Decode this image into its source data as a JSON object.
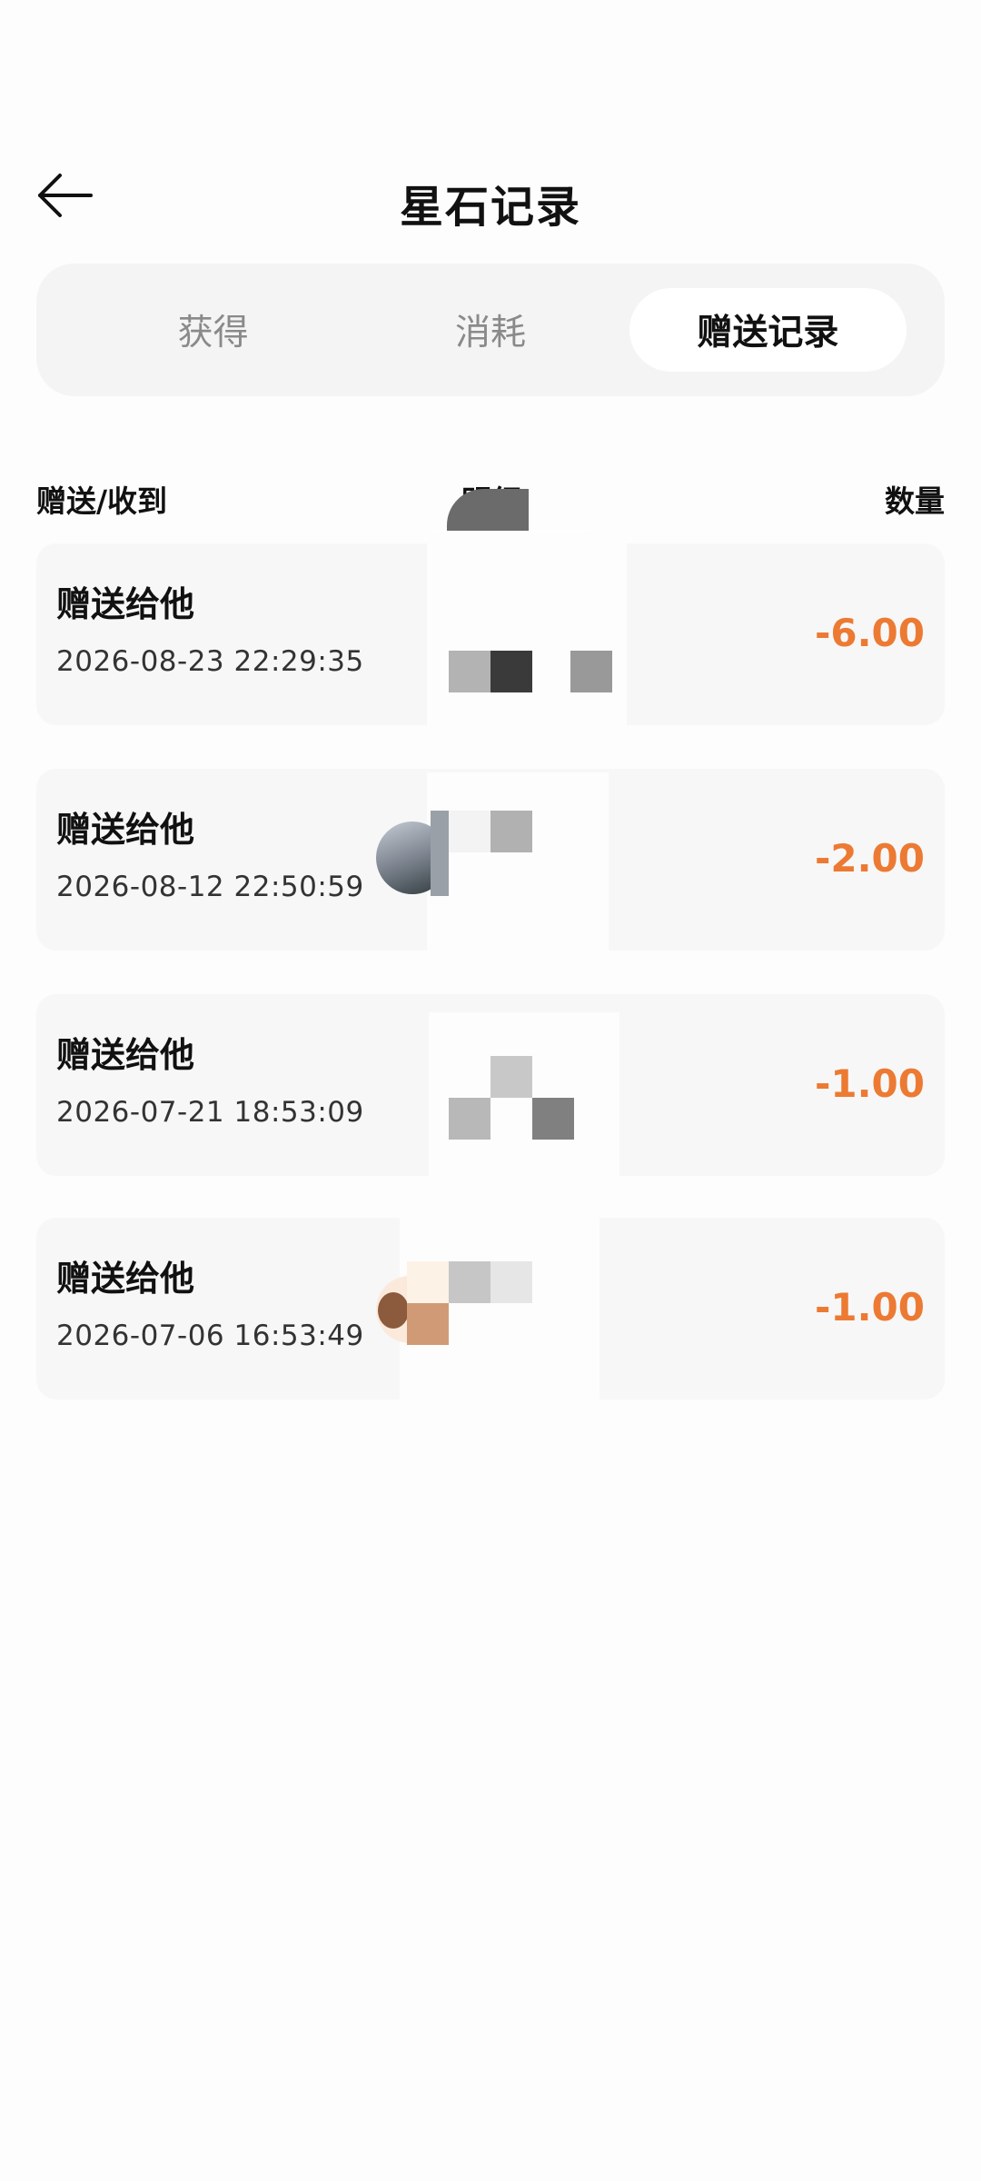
{
  "header": {
    "title": "星石记录",
    "back_icon": "arrow-left-icon"
  },
  "tabs": [
    {
      "label": "获得",
      "active": false
    },
    {
      "label": "消耗",
      "active": false
    },
    {
      "label": "赠送记录",
      "active": true
    }
  ],
  "columns": {
    "left": "赠送/收到",
    "middle": "明细",
    "right": "数量"
  },
  "records": [
    {
      "title": "赠送给他",
      "time": "2026-08-23 22:29:35",
      "amount": "-6.00"
    },
    {
      "title": "赠送给他",
      "time": "2026-08-12 22:50:59",
      "amount": "-2.00"
    },
    {
      "title": "赠送给他",
      "time": "2026-07-21 18:53:09",
      "amount": "-1.00"
    },
    {
      "title": "赠送给他",
      "time": "2026-07-06 16:53:49",
      "amount": "-1.00"
    }
  ],
  "colors": {
    "accent_amount": "#ec7a33",
    "row_background": "#f7f7f7",
    "tab_background": "#f4f4f4"
  }
}
